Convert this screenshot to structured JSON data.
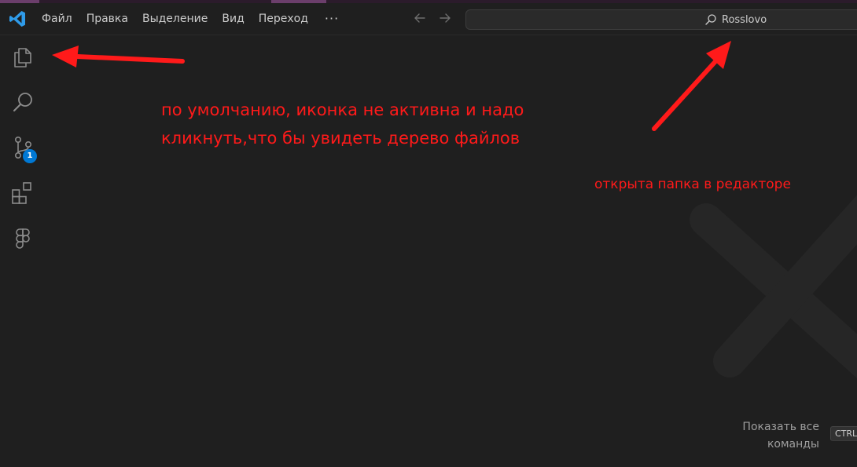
{
  "menu": {
    "items": [
      "Файл",
      "Правка",
      "Выделение",
      "Вид",
      "Переход"
    ],
    "more_label": "···"
  },
  "command_center": {
    "text": "Rosslovo"
  },
  "activity_bar": {
    "scm_badge": "1"
  },
  "annotations": {
    "line1": "по умолчанию, иконка не активна и надо",
    "line2": "кликнуть,что бы увидеть дерево файлов",
    "folder_note": "открыта папка в редакторе"
  },
  "shortcut_hint": {
    "label": "Показать все команды",
    "key": "CTRL"
  },
  "colors": {
    "background": "#1f1f1f",
    "accent": "#0078d4",
    "annotation": "#ff1a1a"
  },
  "icons": [
    "vscode-logo-icon",
    "explorer-icon",
    "search-icon",
    "source-control-icon",
    "extensions-icon",
    "figma-icon",
    "arrow-left-icon",
    "arrow-right-icon"
  ]
}
